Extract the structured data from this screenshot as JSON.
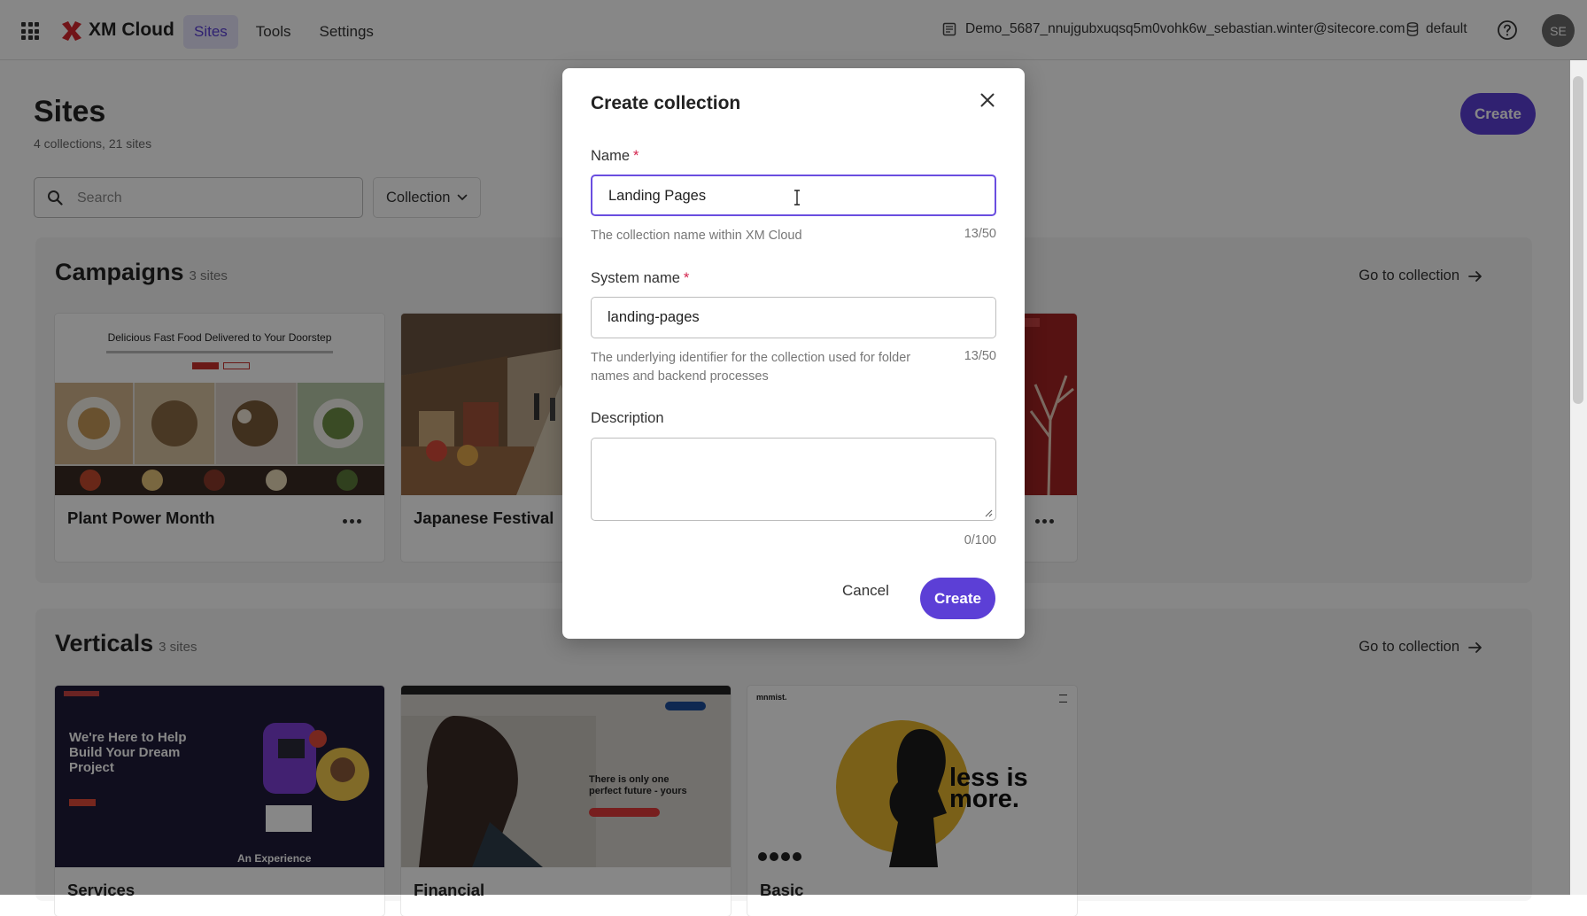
{
  "app": {
    "name": "XM Cloud",
    "nav": [
      {
        "label": "Sites",
        "active": true
      },
      {
        "label": "Tools",
        "active": false
      },
      {
        "label": "Settings",
        "active": false
      }
    ],
    "tenant": "Demo_5687_nnujgubxuqsq5m0vohk6w_sebastian.winter@sitecore.com",
    "environment": "default",
    "avatar_initials": "SE",
    "accent_color": "#5c3fd6"
  },
  "page": {
    "title": "Sites",
    "subtitle": "4 collections, 21 sites",
    "create_label": "Create",
    "search_placeholder": "Search",
    "collection_filter_label": "Collection"
  },
  "sections": [
    {
      "title": "Campaigns",
      "count": "3 sites",
      "goto_label": "Go to collection",
      "cards": [
        {
          "name": "Plant Power Month",
          "thumb_headline": "Delicious Fast Food Delivered to Your Doorstep"
        },
        {
          "name": "Japanese Festival"
        },
        {
          "name": ""
        }
      ]
    },
    {
      "title": "Verticals",
      "count": "3 sites",
      "goto_label": "Go to collection",
      "cards": [
        {
          "name": "Services",
          "thumb_headline": "We're Here to Help Build Your Dream Project",
          "thumb_footer": "An Experience"
        },
        {
          "name": "Financial",
          "thumb_headline": "There is only one perfect future - yours"
        },
        {
          "name": "Basic",
          "thumb_brand": "mnmist.",
          "thumb_headline": "less is more."
        }
      ]
    }
  ],
  "modal": {
    "title": "Create collection",
    "name_label": "Name",
    "name_value": "Landing Pages",
    "name_helper": "The collection name within XM Cloud",
    "name_counter": "13/50",
    "system_label": "System name",
    "system_value": "landing-pages",
    "system_helper": "The underlying identifier for the collection used for folder names and backend processes",
    "system_counter": "13/50",
    "description_label": "Description",
    "description_value": "",
    "description_counter": "0/100",
    "required_mark": "*",
    "cancel_label": "Cancel",
    "create_label": "Create"
  }
}
